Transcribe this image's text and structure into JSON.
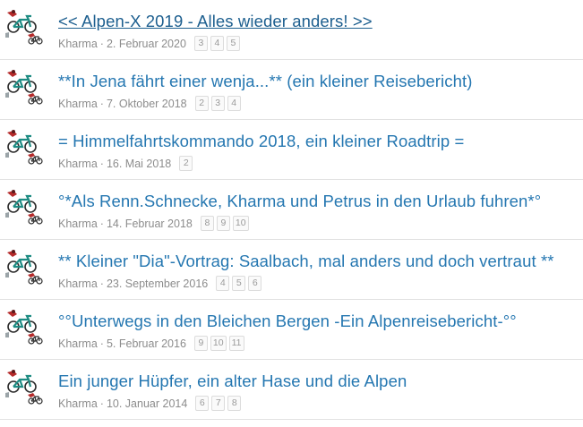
{
  "threads": [
    {
      "title": "<< Alpen-X 2019 - Alles wieder anders! >>",
      "author": "Kharma",
      "date": "2. Februar 2020",
      "pages": [
        "3",
        "4",
        "5"
      ]
    },
    {
      "title": "**In Jena fährt einer wenja...** (ein kleiner Reisebericht)",
      "author": "Kharma",
      "date": "7. Oktober 2018",
      "pages": [
        "2",
        "3",
        "4"
      ]
    },
    {
      "title": "= Himmelfahrtskommando 2018, ein kleiner Roadtrip =",
      "author": "Kharma",
      "date": "16. Mai 2018",
      "pages": [
        "2"
      ]
    },
    {
      "title": "°*Als Renn.Schnecke, Kharma und Petrus in den Urlaub fuhren*°",
      "author": "Kharma",
      "date": "14. Februar 2018",
      "pages": [
        "8",
        "9",
        "10"
      ]
    },
    {
      "title": "** Kleiner \"Dia\"-Vortrag: Saalbach, mal anders und doch vertraut **",
      "author": "Kharma",
      "date": "23. September 2016",
      "pages": [
        "4",
        "5",
        "6"
      ]
    },
    {
      "title": "°°Unterwegs in den Bleichen Bergen -Ein Alpenreisebericht-°°",
      "author": "Kharma",
      "date": "5. Februar 2016",
      "pages": [
        "9",
        "10",
        "11"
      ]
    },
    {
      "title": "Ein junger Hüpfer, ein alter Hase und die Alpen",
      "author": "Kharma",
      "date": "10. Januar 2014",
      "pages": [
        "6",
        "7",
        "8"
      ]
    }
  ],
  "colors": {
    "title_link": "#2577b1",
    "title_hover": "#1d5f8f",
    "meta_text": "#8c8c8c",
    "divider": "#e2e2e2"
  },
  "icons": {
    "avatar": "bicycle-avatar-icon"
  }
}
